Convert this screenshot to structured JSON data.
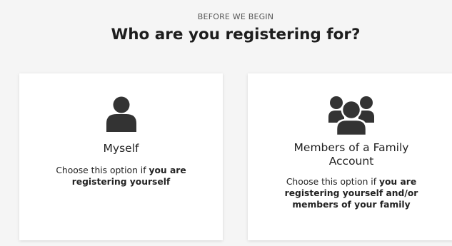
{
  "header": {
    "eyebrow": "BEFORE WE BEGIN",
    "title": "Who are you registering for?"
  },
  "options": [
    {
      "icon": "user-icon",
      "title": "Myself",
      "desc_prefix": "Choose this option if",
      "desc_bold": "you are registering yourself"
    },
    {
      "icon": "family-group-icon",
      "title": "Members of a Family Account",
      "desc_prefix": "Choose this option if",
      "desc_bold": "you are registering yourself and/or members of your family"
    }
  ],
  "colors": {
    "background": "#f5f5f5",
    "card": "#ffffff",
    "icon": "#333333",
    "text": "#222222"
  }
}
